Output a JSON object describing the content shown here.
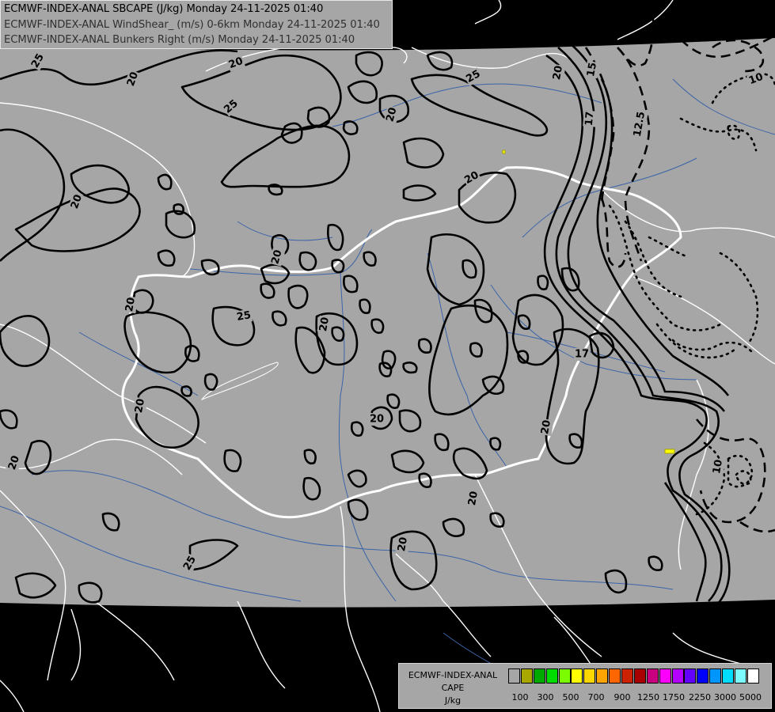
{
  "titles": {
    "line1": "ECMWF-INDEX-ANAL SBCAPE (J/kg) Monday 24-11-2025 01:40",
    "line2": "ECMWF-INDEX-ANAL WindShear_ (m/s) 0-6km Monday 24-11-2025 01:40",
    "line3": "ECMWF-INDEX-ANAL Bunkers Right (m/s) Monday 24-11-2025 01:40"
  },
  "legend": {
    "name_line1": "ECMWF-INDEX-ANAL",
    "name_line2": "CAPE",
    "unit": "J/kg",
    "colors": [
      "#a6a6a6",
      "#a8a800",
      "#00a800",
      "#00dc00",
      "#7cfc00",
      "#ffff00",
      "#ffd700",
      "#ffa500",
      "#ff6600",
      "#cc2200",
      "#a80000",
      "#c80080",
      "#ff00ff",
      "#b400ff",
      "#6400ff",
      "#0000ff",
      "#0096ff",
      "#00dcff",
      "#7cfcff",
      "#ffffff"
    ],
    "tick_labels": [
      "100",
      "300",
      "500",
      "700",
      "900",
      "1250",
      "1750",
      "2250",
      "3000",
      "5000"
    ]
  },
  "contour_labels": [
    {
      "text": "25"
    },
    {
      "text": "20"
    },
    {
      "text": "20"
    },
    {
      "text": "25"
    },
    {
      "text": "25"
    },
    {
      "text": "20"
    },
    {
      "text": "15"
    },
    {
      "text": "10"
    },
    {
      "text": "20"
    },
    {
      "text": "12.5"
    },
    {
      "text": "17"
    },
    {
      "text": "20"
    },
    {
      "text": "20"
    },
    {
      "text": "20"
    },
    {
      "text": "25"
    },
    {
      "text": "20"
    },
    {
      "text": "17"
    },
    {
      "text": "20"
    },
    {
      "text": "20"
    },
    {
      "text": "20"
    },
    {
      "text": "20"
    },
    {
      "text": "20"
    },
    {
      "text": "10"
    },
    {
      "text": "20"
    },
    {
      "text": "25"
    },
    {
      "text": "20"
    }
  ],
  "colors": {
    "background": "#000000",
    "domain_fill": "#a6a6a6",
    "border_primary": "#ffffff",
    "river": "#3b64a8",
    "contour": "#000000"
  }
}
